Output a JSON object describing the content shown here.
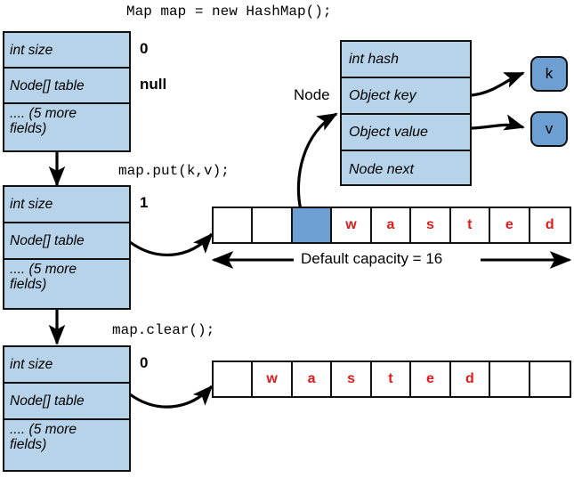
{
  "title_code": "Map map = new HashMap();",
  "steps": [
    {
      "id": "after-construction",
      "code": null,
      "size_label": "int size",
      "size_value": "0",
      "table_label": "Node[] table",
      "table_value": "null",
      "more_fields_line1": ".... (5 more",
      "more_fields_line2": "fields)"
    },
    {
      "id": "after-put",
      "code": "map.put(k,v);",
      "size_label": "int size",
      "size_value": "1",
      "table_label": "Node[] table",
      "table_value": "",
      "more_fields_line1": ".... (5 more",
      "more_fields_line2": "fields)"
    },
    {
      "id": "after-clear",
      "code": "map.clear();",
      "size_label": "int size",
      "size_value": "0",
      "table_label": "Node[] table",
      "table_value": "",
      "more_fields_line1": ".... (5 more",
      "more_fields_line2": "fields)"
    }
  ],
  "node": {
    "caption": "Node",
    "fields": [
      "int hash",
      "Object key",
      "Object value",
      "Node next"
    ],
    "key_box": "k",
    "value_box": "v"
  },
  "arrays": {
    "after_put": {
      "caption": "Default capacity = 16",
      "cells": [
        {
          "text": "",
          "filled": false
        },
        {
          "text": "",
          "filled": false
        },
        {
          "text": "",
          "filled": true
        },
        {
          "text": "w",
          "filled": false
        },
        {
          "text": "a",
          "filled": false
        },
        {
          "text": "s",
          "filled": false
        },
        {
          "text": "t",
          "filled": false
        },
        {
          "text": "e",
          "filled": false
        },
        {
          "text": "d",
          "filled": false
        }
      ]
    },
    "after_clear": {
      "cells": [
        {
          "text": "",
          "filled": false
        },
        {
          "text": "w",
          "filled": false
        },
        {
          "text": "a",
          "filled": false
        },
        {
          "text": "s",
          "filled": false
        },
        {
          "text": "t",
          "filled": false
        },
        {
          "text": "e",
          "filled": false
        },
        {
          "text": "d",
          "filled": false
        },
        {
          "text": "",
          "filled": false
        },
        {
          "text": "",
          "filled": false
        }
      ]
    }
  },
  "colors": {
    "field_fill": "#b6d3ea",
    "highlight_fill": "#6d9fd2",
    "stroke": "#111111",
    "wasted_text": "#e01b1b",
    "background": "#ffffff"
  }
}
